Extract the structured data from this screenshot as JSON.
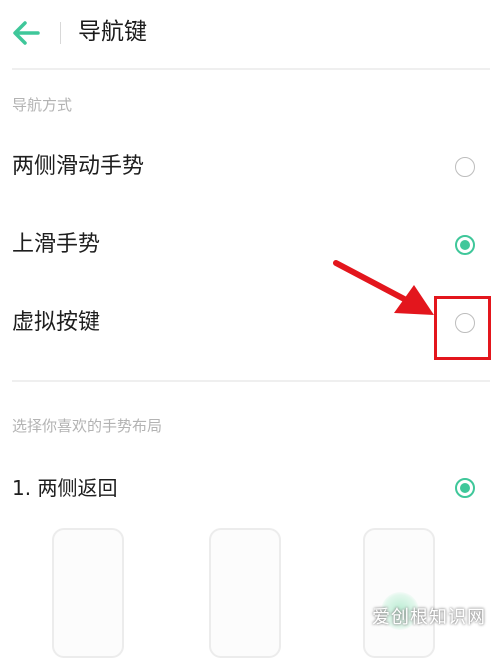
{
  "header": {
    "title": "导航键",
    "back_icon": "arrow-left-icon"
  },
  "sections": [
    {
      "label": "导航方式",
      "options": [
        {
          "label": "两侧滑动手势",
          "selected": false
        },
        {
          "label": "上滑手势",
          "selected": true
        },
        {
          "label": "虚拟按键",
          "selected": false
        }
      ]
    },
    {
      "label": "选择你喜欢的手势布局",
      "options": [
        {
          "label": "1. 两侧返回",
          "selected": true
        }
      ]
    }
  ],
  "watermark": "爱创根知识网",
  "colors": {
    "accent": "#3fc79a",
    "annotation": "#e3161d"
  }
}
